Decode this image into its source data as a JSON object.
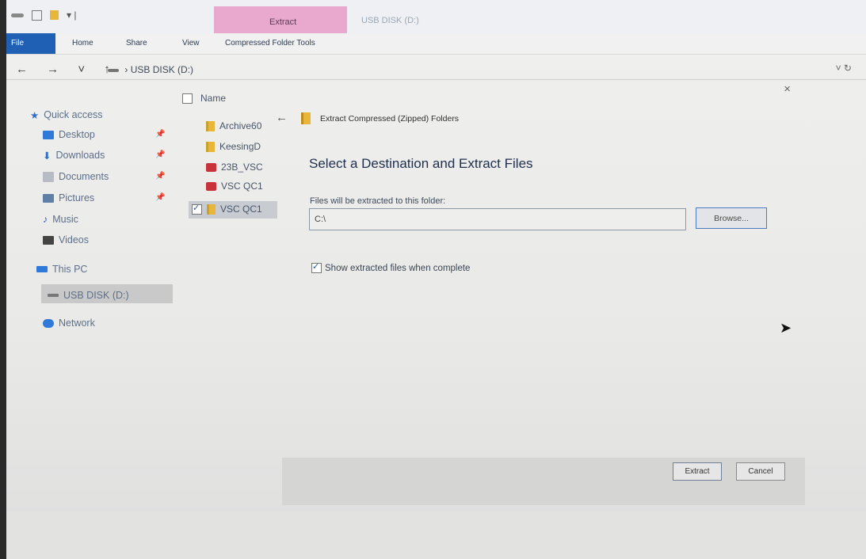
{
  "title_bar": {
    "context_tab": "Extract",
    "window_title": "USB DISK (D:)"
  },
  "ribbon": {
    "tabs": [
      "File",
      "Home",
      "Share",
      "View",
      "Compressed Folder Tools"
    ]
  },
  "address": {
    "nav_arrows": "← → ˅ ↑",
    "crumb": "USB DISK (D:)"
  },
  "nav_pane": {
    "quick_access": "Quick access",
    "items": [
      "Desktop",
      "Downloads",
      "Documents",
      "Pictures",
      "Music",
      "Videos"
    ],
    "this_pc": "This PC",
    "usb": "USB DISK (D:)",
    "network": "Network"
  },
  "file_list": {
    "header": "Name",
    "items": [
      "Archive60",
      "KeesingD",
      "23B_VSC",
      "VSC QC1",
      "VSC QC1"
    ]
  },
  "dialog": {
    "title": "Extract Compressed (Zipped) Folders",
    "heading": "Select a Destination and Extract Files",
    "path_label": "Files will be extracted to this folder:",
    "path_value": "C:\\",
    "browse_label": "Browse...",
    "show_files_label": "Show extracted files when complete",
    "show_files_checked": true,
    "extract_label": "Extract",
    "cancel_label": "Cancel",
    "close_glyph": "×",
    "back_glyph": "←"
  },
  "colors": {
    "file_tab": "#1f5fb4",
    "context_tab": "#e9a9cf",
    "selection": "#c9c9c9",
    "zip_icon": "#e8b63b"
  }
}
